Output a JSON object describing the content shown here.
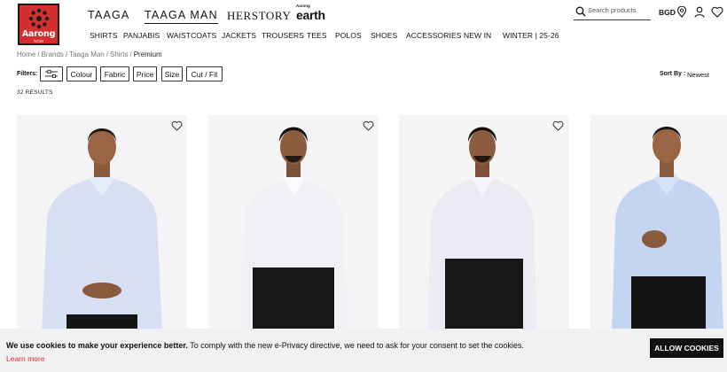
{
  "logo": {
    "name": "Aarong",
    "subtitle": "আড়ং"
  },
  "brands": [
    {
      "label": "TAAGA"
    },
    {
      "label": "TAAGA MAN",
      "active": true
    },
    {
      "label": "HERSTORY"
    },
    {
      "label_top": "Aarong",
      "label_main": "earth"
    }
  ],
  "search": {
    "placeholder": "Search products",
    "icon": "search-icon"
  },
  "header": {
    "region": "BGD",
    "icons": [
      "location-pin-icon",
      "user-icon",
      "heart-icon"
    ]
  },
  "nav": [
    "SHIRTS",
    "PANJABIS",
    "WAISTCOATS",
    "JACKETS",
    "TROUSERS",
    "TEES",
    "POLOS",
    "SHOES",
    "ACCESSORIES",
    "NEW IN",
    "WINTER | 25-26"
  ],
  "breadcrumb": [
    "Home",
    "Brands",
    "Taaga Man",
    "Shirts",
    "Premium"
  ],
  "filters": {
    "label": "Filters:",
    "options_icon": "sliders-icon",
    "buttons": [
      "Colour",
      "Fabric",
      "Price",
      "Size",
      "Cut / Fit"
    ]
  },
  "sort": {
    "label": "Sort By :",
    "value": "Newest"
  },
  "results": "32 RESULTS",
  "products": [
    {
      "shirt_color": "#d7dff2",
      "wishlist_icon": "heart-outline-icon"
    },
    {
      "shirt_color": "#f1f2f7",
      "wishlist_icon": "heart-outline-icon"
    },
    {
      "shirt_color": "#ecebf5",
      "wishlist_icon": "heart-outline-icon"
    },
    {
      "shirt_color": "#c3d5f0",
      "wishlist_icon": "heart-outline-icon"
    }
  ],
  "cookie": {
    "bold": "We use cookies to make your experience better.",
    "text": " To comply with the new e-Privacy directive, we need to ask for your consent to set the cookies.",
    "learn_more": "Learn more",
    "allow": "ALLOW COOKIES"
  },
  "colors": {
    "brand_red": "#d32f2f",
    "link_red": "#e0262b",
    "button_black": "#111111"
  }
}
